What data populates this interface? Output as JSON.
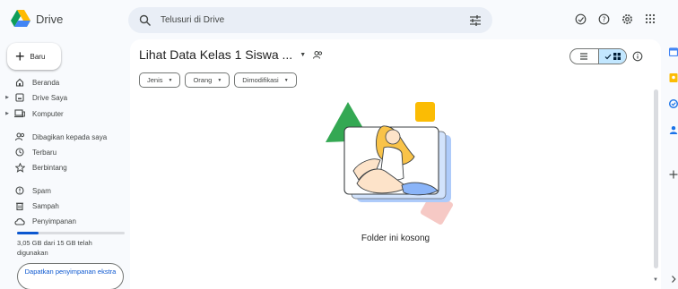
{
  "app": {
    "name": "Drive"
  },
  "search": {
    "placeholder": "Telusuri di Drive"
  },
  "sidebar": {
    "new_label": "Baru",
    "items": [
      {
        "label": "Beranda",
        "icon": "home-icon"
      },
      {
        "label": "Drive Saya",
        "icon": "my-drive-icon",
        "expandable": true
      },
      {
        "label": "Komputer",
        "icon": "computer-icon",
        "expandable": true
      },
      {
        "label": "Dibagikan kepada saya",
        "icon": "shared-icon"
      },
      {
        "label": "Terbaru",
        "icon": "clock-icon"
      },
      {
        "label": "Berbintang",
        "icon": "star-icon"
      },
      {
        "label": "Spam",
        "icon": "spam-icon"
      },
      {
        "label": "Sampah",
        "icon": "trash-icon"
      },
      {
        "label": "Penyimpanan",
        "icon": "cloud-icon"
      }
    ],
    "storage_text": "3,05 GB dari 15 GB telah digunakan",
    "storage_fraction": 0.2,
    "storage_button": "Dapatkan penyimpanan ekstra"
  },
  "main": {
    "folder_title": "Lihat Data Kelas 1 Siswa ...",
    "filters": [
      "Jenis",
      "Orang",
      "Dimodifikasi"
    ],
    "empty_text": "Folder ini kosong"
  },
  "colors": {
    "accent": "#0b57d0",
    "toggle_active": "#c2e7ff",
    "background": "#f8fafd"
  }
}
